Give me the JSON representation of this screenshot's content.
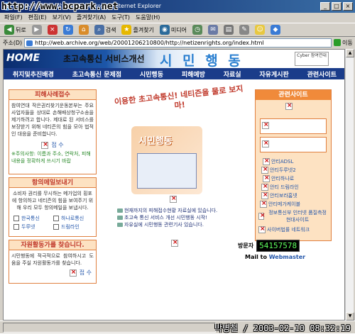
{
  "window": {
    "title": "위한 시.민.행.동 [참여연대] - Microsoft Internet Explorer",
    "watermark": "http://www.bcpark.net"
  },
  "menu": [
    "파일(F)",
    "편집(E)",
    "보기(V)",
    "즐겨찾기(A)",
    "도구(T)",
    "도움말(H)"
  ],
  "toolbar": {
    "back": "뒤로",
    "search": "검색",
    "favorites": "즐겨찾기",
    "media": "미디어"
  },
  "address": {
    "label": "주소(D)",
    "url": "http://web.archive.org/web/20001206210800/http://netizenrights.org/index.html",
    "go": "이동"
  },
  "banner": {
    "home": "HOME",
    "subtitle": "초고속통신 서비스개선",
    "title": "시 민 행 동",
    "logo_text": "Cyber 참여연대"
  },
  "nav": [
    "취지및추진배경",
    "초고속통신 문제점",
    "시민행동",
    "피해예방",
    "자료실",
    "자유게시판",
    "관련사이트"
  ],
  "report": {
    "heading": "피해사례접수",
    "body": "참여연대 작은권리찾기운동본부는 주요 사업자들을 상대로 손해배상청구소송을 제기하려고 합니다. 제대로 된 서비스를 보장받기 위해 네티즌의 힘을 모아 법적인 대응을 준비합니다.",
    "submit": "접 수",
    "note": "※주의사항: 이름과 주소, 연락처, 피해 내용을 정확하게 쓰시기 바랍"
  },
  "protest": {
    "heading": "항의메일보내기",
    "body": "소비자 권리를 무시하는 메가업의 횡포에 항의하고 네티즌의 힘을 보여주기 위해 우리 모두 항의메일을 보냅시다.",
    "checks": [
      "한국통신",
      "하나로통신",
      "두루넷",
      "드림라인"
    ]
  },
  "volunteer": {
    "heading": "자원활동가를 찾습니다.",
    "body": "시민행동에 적극적으로 참여하시고 도움을 주실 자원활동가를 찾습니다.",
    "submit": "접 수"
  },
  "center": {
    "slogan": "이용한 초고속통신! 네티즌을 물로 보지마!",
    "headline": "시민행동",
    "bullets": [
      "현재까지의 피해접수현황 자료실에 있습니다.",
      "초고속 통신 서비스 개선 시민행동 시작!",
      "자유실에 시민행동 관련기사 있습니다."
    ]
  },
  "links": {
    "heading": "관련사이트",
    "sites": [
      "안티ADSL",
      "안티두루넷2",
      "안티하나로",
      "안티 드림라인",
      "안티보라홈넷",
      "안티메가케이블",
      "정보통신부 인터넷 품질측정 현대사이트",
      "사이버법률 네트워크"
    ]
  },
  "visitor": {
    "label": "방문자",
    "count": "54157578"
  },
  "mail": {
    "prefix": "Mail to ",
    "link": "Webmaster"
  },
  "stamp": "박병철 / 2003-02-10 08:32:19"
}
